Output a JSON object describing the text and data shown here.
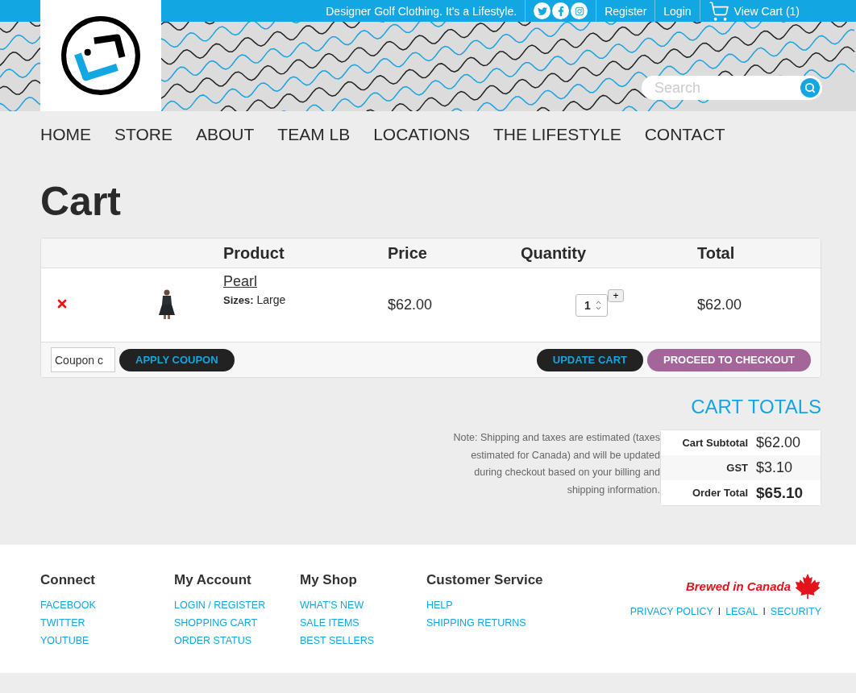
{
  "top_bar": {
    "tagline": "Designer Golf Clothing. It's a Lifestyle.",
    "links": [
      "Register",
      "Login"
    ],
    "cart_link": "View Cart (1)"
  },
  "search": {
    "placeholder": "Search"
  },
  "nav": [
    "HOME",
    "STORE",
    "ABOUT",
    "TEAM LB",
    "LOCATIONS",
    "THE LIFESTYLE",
    "CONTACT"
  ],
  "page_title": "Cart",
  "cart_table": {
    "columns": [
      "Product",
      "Price",
      "Quantity",
      "Total"
    ],
    "rows": [
      {
        "product": "Pearl",
        "sizes_label": "Sizes:",
        "size": "Large",
        "price": "$62.00",
        "quantity": "1",
        "increment": "+",
        "total": "$62.00"
      }
    ]
  },
  "coupon": {
    "placeholder": "Coupon c"
  },
  "buttons": [
    {
      "kind": "dark",
      "label": "APPLY COUPON"
    },
    {
      "kind": "dark",
      "label": "UPDATE CART"
    },
    {
      "kind": "purple",
      "label": "PROCEED TO CHECKOUT"
    }
  ],
  "cart_totals": {
    "title": "CART TOTALS",
    "note": "Note: Shipping and taxes are estimated (taxes estimated for Canada) and will be updated during checkout based on your billing and shipping information.",
    "rows": [
      {
        "kind": "line",
        "label": "Cart Subtotal",
        "value": "$62.00"
      },
      {
        "kind": "line",
        "label": "GST",
        "value": "$3.10"
      },
      {
        "kind": "total",
        "label": "Order Total",
        "value": "$65.10"
      }
    ]
  },
  "footer": {
    "columns": [
      {
        "heading": "Connect",
        "links": [
          "FACEBOOK",
          "TWITTER",
          "YOUTUBE"
        ]
      },
      {
        "heading": "My Account",
        "links": [
          "LOGIN / REGISTER",
          "SHOPPING CART",
          "ORDER STATUS"
        ]
      },
      {
        "heading": "My Shop",
        "links": [
          "WHAT'S NEW",
          "SALE ITEMS",
          "BEST SELLERS"
        ]
      },
      {
        "heading": "Customer Service",
        "links": [
          "HELP",
          "SHIPPING RETURNS"
        ]
      }
    ],
    "brand": "Brewed in Canada",
    "separators": [
      "I",
      "I"
    ],
    "legal_links": [
      "PRIVACY POLICY",
      "LEGAL",
      "SECURITY"
    ]
  }
}
